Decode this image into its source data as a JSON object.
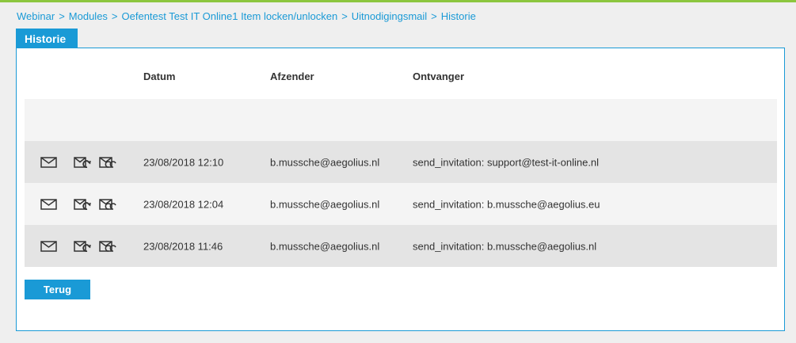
{
  "breadcrumb": [
    {
      "label": "Webinar"
    },
    {
      "label": "Modules"
    },
    {
      "label": "Oefentest Test IT Online1 Item locken/unlocken"
    },
    {
      "label": "Uitnodigingsmail"
    },
    {
      "label": "Historie"
    }
  ],
  "breadcrumb_separator": ">",
  "panel": {
    "title": "Historie"
  },
  "table": {
    "headers": {
      "datum": "Datum",
      "afzender": "Afzender",
      "ontvanger": "Ontvanger"
    },
    "rows": [
      {
        "datum": "23/08/2018 12:10",
        "afzender": "b.mussche@aegolius.nl",
        "ontvanger": "send_invitation: support@test-it-online.nl"
      },
      {
        "datum": "23/08/2018 12:04",
        "afzender": "b.mussche@aegolius.nl",
        "ontvanger": "send_invitation: b.mussche@aegolius.eu"
      },
      {
        "datum": "23/08/2018 11:46",
        "afzender": "b.mussche@aegolius.nl",
        "ontvanger": "send_invitation: b.mussche@aegolius.nl"
      }
    ]
  },
  "actions": {
    "back_label": "Terug"
  },
  "icons": [
    "mail-icon",
    "resend-mail-icon",
    "resend-all-mail-icon"
  ],
  "colors": {
    "accent": "#1a9ad6",
    "topline": "#8cc63f",
    "row_dark": "#e4e4e4",
    "row_light": "#f4f4f4"
  }
}
